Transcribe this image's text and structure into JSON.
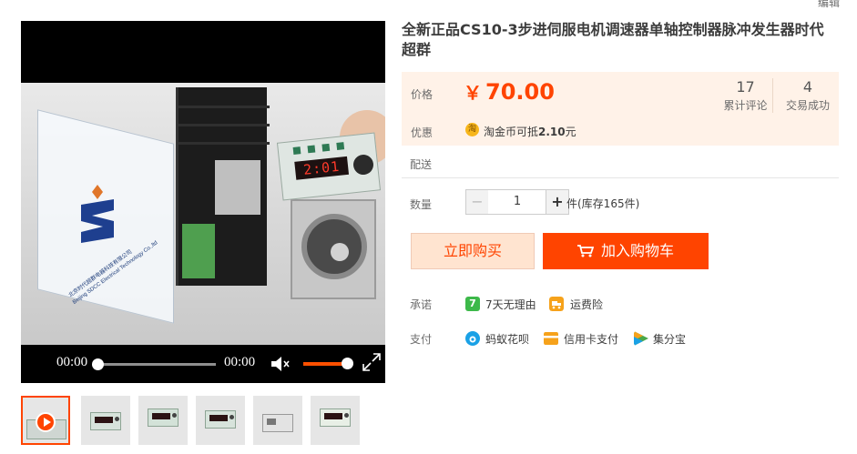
{
  "header": {
    "edit_label": "编辑"
  },
  "product": {
    "title": "全新正品CS10-3步进伺服电机调速器单轴控制器脉冲发生器时代超群"
  },
  "player": {
    "current_time": "00:00",
    "duration": "00:00",
    "progress": 0,
    "volume": 1.0,
    "muted": true,
    "display_reading": "2:01",
    "brand_text_cn": "北京时代超群电器科技有限公司",
    "brand_text_en": "Beijing SDCC Electrical Technology Co.,ltd"
  },
  "thumbnails": [
    {
      "label": "video",
      "active": true
    },
    {
      "label": "image-2",
      "active": false
    },
    {
      "label": "image-3",
      "active": false
    },
    {
      "label": "image-4",
      "active": false
    },
    {
      "label": "image-5",
      "active": false
    },
    {
      "label": "image-6",
      "active": false
    }
  ],
  "price": {
    "label": "价格",
    "currency": "￥",
    "value": "70.00",
    "reviews_count": "17",
    "reviews_label": "累计评论",
    "trades_count": "4",
    "trades_label": "交易成功",
    "color": "#ff4400"
  },
  "promo": {
    "label": "优惠",
    "icon_text": "淘",
    "text_prefix": "淘金币可抵",
    "amount": "2.10",
    "text_suffix": "元"
  },
  "delivery": {
    "label": "配送"
  },
  "quantity": {
    "label": "数量",
    "minus": "−",
    "value": "1",
    "plus": "+",
    "stock_text": "件(库存165件)"
  },
  "actions": {
    "buy_now": "立即购买",
    "add_to_cart": "加入购物车"
  },
  "promise": {
    "label": "承诺",
    "items": [
      {
        "icon": "seven-day-return-icon",
        "icon_text": "7",
        "text": "7天无理由",
        "color": "#3db94a"
      },
      {
        "icon": "shipping-insurance-icon",
        "icon_text": "",
        "text": "运费险",
        "color": "#f6a21b"
      }
    ]
  },
  "payment": {
    "label": "支付",
    "items": [
      {
        "icon": "huabei-icon",
        "text": "蚂蚁花呗",
        "color": "#1aa1e6"
      },
      {
        "icon": "credit-card-icon",
        "text": "信用卡支付",
        "color": "#f6a21b"
      },
      {
        "icon": "jifenbao-icon",
        "text": "集分宝",
        "color": "#4aa84a"
      }
    ]
  }
}
